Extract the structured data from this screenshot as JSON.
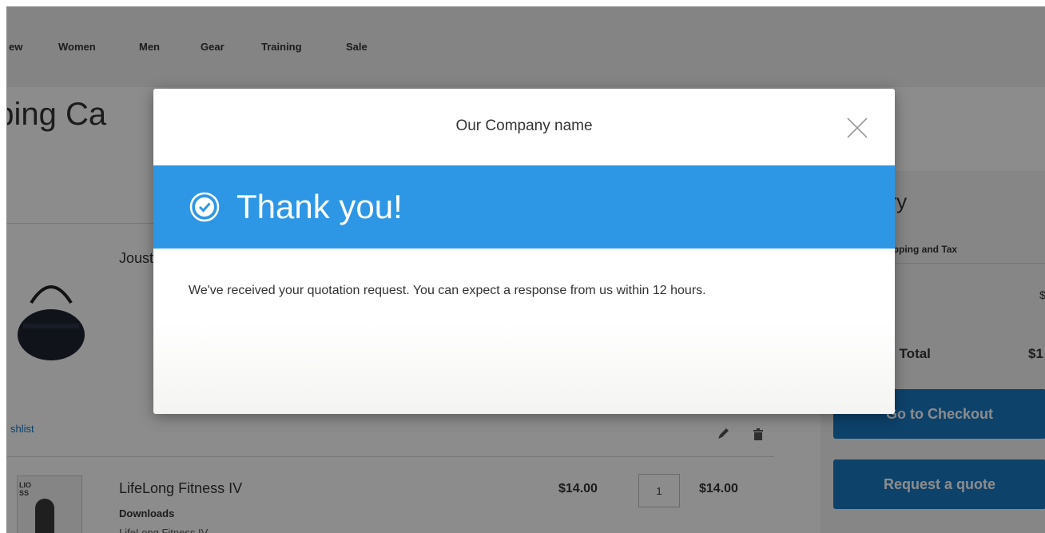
{
  "nav": {
    "items": [
      "ew",
      "Women",
      "Men",
      "Gear",
      "Training",
      "Sale"
    ]
  },
  "page": {
    "title": "pping Ca"
  },
  "cart": {
    "item1": {
      "name": "Joust",
      "wishlist_link": "shlist"
    },
    "item2": {
      "name": "LifeLong Fitness IV",
      "category": "Downloads",
      "sub_name": "LifeLong Fitness IV",
      "thumb_text": "LIO\nSS",
      "price": "$14.00",
      "qty": "1",
      "subtotal": "$14.00"
    }
  },
  "summary": {
    "title": "ary",
    "shipping_label": "hipping and Tax",
    "shipping_value": "$",
    "total_label": "ed Total",
    "total_value": "$1",
    "checkout_label": "Go to Checkout",
    "quote_label": "Request a quote"
  },
  "modal": {
    "company": "Our Company name",
    "heading": "Thank you!",
    "message": "We've received your quotation request. You can expect a response from us within 12 hours."
  },
  "colors": {
    "banner": "#2d97e5",
    "button": "#1979c3",
    "link": "#1979c3"
  },
  "icons": [
    "close-icon",
    "check-circle-icon",
    "edit-icon",
    "trash-icon"
  ]
}
